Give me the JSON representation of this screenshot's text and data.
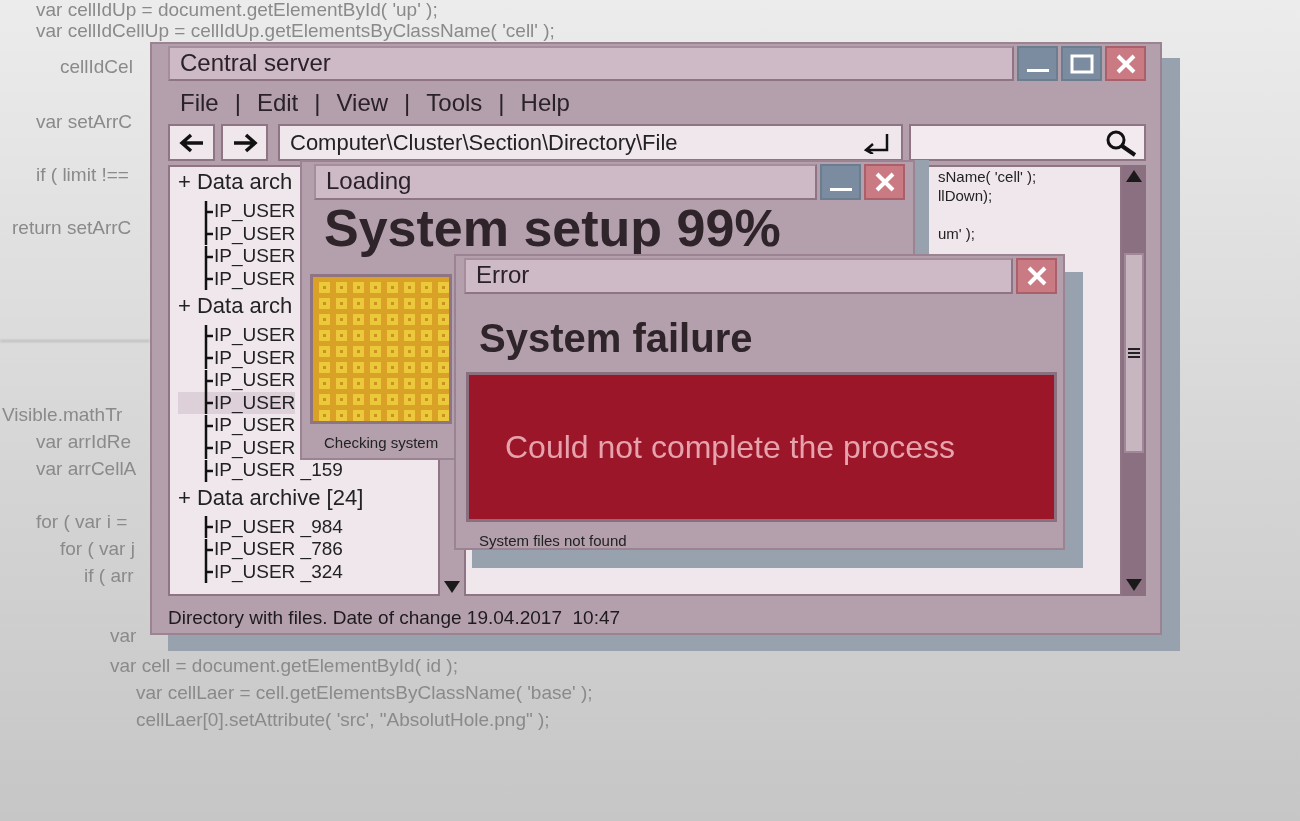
{
  "background_code": [
    "var cellIdUp = document.getElementById( 'up' );",
    "var cellIdCellUp = cellIdUp.getElementsByClassName( 'cell' );",
    "cellIdCel",
    "var setArrC",
    "if ( limit !==",
    "return setArrC",
    "Visible.mathTr",
    "var arrIdRe",
    "var arrCellA",
    "for ( var i =",
    "for ( var j",
    "if ( arr",
    "var",
    "var cell = document.getElementById( id );",
    "var cellLaer = cell.getElementsByClassName( 'base' );",
    "cellLaer[0].setAttribute( 'src', \"AbsolutHole.png\" );"
  ],
  "main_window": {
    "title": "Central server",
    "menu": [
      "File",
      "Edit",
      "View",
      "Tools",
      "Help"
    ],
    "menu_separator": "|",
    "address": "Computer\\Cluster\\Section\\Directory\\File",
    "tree": [
      {
        "label": "+ Data arch",
        "children": [
          {
            "label": "IP_USER",
            "selected": false
          },
          {
            "label": "IP_USER",
            "selected": false
          },
          {
            "label": "IP_USER",
            "selected": false
          },
          {
            "label": "IP_USER",
            "selected": false
          }
        ]
      },
      {
        "label": "+ Data arch",
        "children": [
          {
            "label": "IP_USER",
            "selected": false
          },
          {
            "label": "IP_USER",
            "selected": false
          },
          {
            "label": "IP_USER",
            "selected": false
          },
          {
            "label": "IP_USER",
            "selected": true
          },
          {
            "label": "IP_USER",
            "selected": false
          },
          {
            "label": "IP_USER",
            "selected": false
          },
          {
            "label": "IP_USER _159",
            "selected": false
          }
        ]
      },
      {
        "label": "+ Data archive [24]",
        "children": [
          {
            "label": "IP_USER _984",
            "selected": false
          },
          {
            "label": "IP_USER _786",
            "selected": false
          },
          {
            "label": "IP_USER _324",
            "selected": false
          }
        ]
      }
    ],
    "code_blocks": [
      [
        "sName( 'cell' );",
        "llDown);"
      ],
      [
        "um' );"
      ]
    ],
    "status": "Directory with files. Date of change 19.04.2017  10:47"
  },
  "loading_window": {
    "title": "Loading",
    "heading": "System setup 99%",
    "message": "Checking system"
  },
  "error_window": {
    "title": "Error",
    "heading": "System failure",
    "alert": "Could not complete the process",
    "message": "System files not found"
  }
}
